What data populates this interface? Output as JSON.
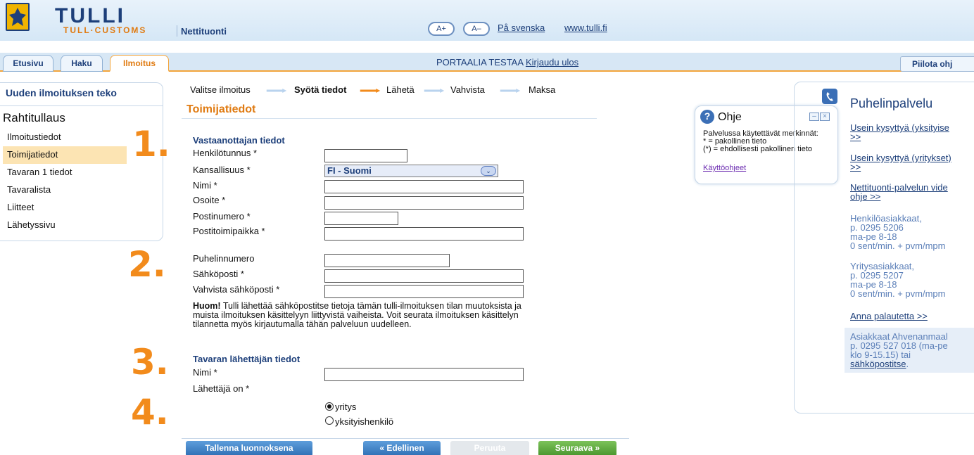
{
  "header": {
    "brand": "TULLI",
    "brand_sub": "TULL·CUSTOMS",
    "service": "Nettituonti",
    "font_plus": "A+",
    "font_minus": "A–",
    "link_swedish": "På svenska",
    "link_site": "www.tulli.fi"
  },
  "tabs": [
    {
      "label": "Etusivu"
    },
    {
      "label": "Haku"
    },
    {
      "label": "Ilmoitus",
      "active": true
    }
  ],
  "portal": {
    "user": "PORTAALIA TESTAA",
    "logout": "Kirjaudu ulos"
  },
  "hide_help": "Piilota ohj",
  "sidebar": {
    "title": "Uuden ilmoituksen teko",
    "subtitle": "Rahtitullaus",
    "items": [
      {
        "label": "Ilmoitustiedot"
      },
      {
        "label": "Toimijatiedot",
        "active": true
      },
      {
        "label": "Tavaran 1 tiedot"
      },
      {
        "label": "Tavaralista"
      },
      {
        "label": "Liitteet"
      },
      {
        "label": "Lähetyssivu"
      }
    ]
  },
  "annotations": [
    "1.",
    "2.",
    "3.",
    "4."
  ],
  "steps": [
    "Valitse ilmoitus",
    "Syötä tiedot",
    "Lähetä",
    "Vahvista",
    "Maksa"
  ],
  "section_title": "Toimijatiedot",
  "receiver": {
    "title": "Vastaanottajan tiedot",
    "fields": {
      "henkilotunnus": "Henkilötunnus *",
      "kansallisuus": "Kansallisuus *",
      "nimi": "Nimi *",
      "osoite": "Osoite *",
      "postinumero": "Postinumero *",
      "postitoimipaikka": "Postitoimipaikka *",
      "puhelin": "Puhelinnumero",
      "sahkoposti": "Sähköposti *",
      "vahvista": "Vahvista sähköposti *"
    },
    "nationality_value": "FI - Suomi"
  },
  "note": {
    "bold": "Huom!",
    "text": " Tulli lähettää sähköpostitse tietoja tämän tulli-ilmoituksen tilan muutoksista ja muista ilmoituksen käsittelyyn liittyvistä vaiheista. Voit seurata ilmoituksen käsittelyn tilannetta myös kirjautumalla tähän palveluun uudelleen."
  },
  "sender": {
    "title": "Tavaran lähettäjän tiedot",
    "name_label": "Nimi *",
    "type_label": "Lähettäjä on *",
    "options": [
      {
        "label": "yritys",
        "selected": true
      },
      {
        "label": "yksityishenkilö",
        "selected": false
      }
    ]
  },
  "buttons": {
    "save_draft": "Tallenna luonnoksena",
    "previous": "Edellinen",
    "cancel": "Peruuta",
    "next": "Seuraava"
  },
  "help": {
    "title": "Ohje",
    "line1": "Palvelussa käytettävät merkinnät:",
    "line2": "* = pakollinen tieto",
    "line3": "(*) = ehdollisesti pakollinen tieto",
    "link": "Käyttöohjeet"
  },
  "phone_panel": {
    "title": "Puhelinpalvelu",
    "link1a": "Usein kysyttyä (yksityise",
    "link1b": ">>",
    "link2a": "Usein kysyttyä (yritykset)",
    "link2b": ">>",
    "link3a": "Nettituonti-palvelun vide",
    "link3b": "ohje >>",
    "private": [
      "Henkilöasiakkaat,",
      "p. 0295 5206",
      "ma-pe 8-18",
      "0 sent/min. + pvm/mpm"
    ],
    "business": [
      "Yritysasiakkaat,",
      "p. 0295 5207",
      "ma-pe 8-18",
      "0 sent/min. + pvm/mpm"
    ],
    "feedback": "Anna palautetta >>",
    "aland": [
      "Asiakkaat Ahvenanmaal",
      "p. 0295 527 018 (ma-pe",
      "klo 9-15.15) tai"
    ],
    "aland_link": "sähköpostitse",
    "aland_end": "."
  },
  "colors": {
    "brand_blue": "#1d3f7a",
    "accent_orange": "#e07b12",
    "button_blue": "#3b82c8",
    "button_green": "#58a83a"
  }
}
